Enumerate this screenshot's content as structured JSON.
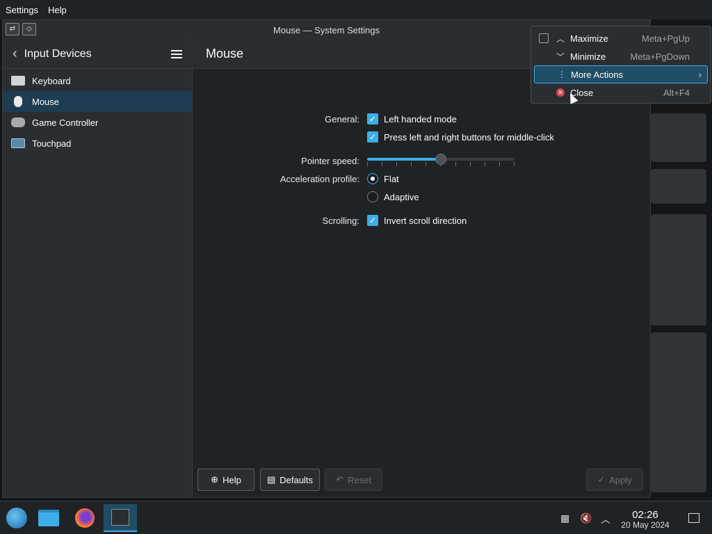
{
  "menubar": {
    "items": [
      "Settings",
      "Help"
    ]
  },
  "window": {
    "title": "Mouse — System Settings",
    "titlebar_icons": [
      "pin-icon",
      "keep-above-icon"
    ]
  },
  "sidebar": {
    "back_label": "Input Devices",
    "items": [
      {
        "label": "Keyboard",
        "icon": "keyboard-icon",
        "active": false
      },
      {
        "label": "Mouse",
        "icon": "mouse-icon",
        "active": true
      },
      {
        "label": "Game Controller",
        "icon": "gamepad-icon",
        "active": false
      },
      {
        "label": "Touchpad",
        "icon": "touchpad-icon",
        "active": false
      }
    ]
  },
  "main": {
    "title": "Mouse",
    "general_label": "General:",
    "left_handed_label": "Left handed mode",
    "left_handed_checked": true,
    "middle_click_label": "Press left and right buttons for middle-click",
    "middle_click_checked": true,
    "pointer_speed_label": "Pointer speed:",
    "pointer_speed_value": 0.5,
    "accel_label": "Acceleration profile:",
    "accel_options": [
      "Flat",
      "Adaptive"
    ],
    "accel_selected": "Flat",
    "scrolling_label": "Scrolling:",
    "invert_scroll_label": "Invert scroll direction",
    "invert_scroll_checked": true
  },
  "buttons": {
    "help": "Help",
    "defaults": "Defaults",
    "reset": "Reset",
    "apply": "Apply"
  },
  "context_menu": {
    "items": [
      {
        "label": "Maximize",
        "shortcut": "Meta+PgUp",
        "icon": "chevron-up-icon"
      },
      {
        "label": "Minimize",
        "shortcut": "Meta+PgDown",
        "icon": "chevron-down-icon"
      },
      {
        "label": "More Actions",
        "shortcut": "",
        "icon": "more-vertical-icon"
      },
      {
        "label": "Close",
        "shortcut": "Alt+F4",
        "icon": "close-icon"
      }
    ],
    "highlighted": "More Actions"
  },
  "taskbar": {
    "apps": [
      "start-menu-icon",
      "file-manager-icon",
      "firefox-icon",
      "system-settings-icon"
    ],
    "time": "02:26",
    "date": "20 May 2024"
  },
  "colors": {
    "accent": "#3daee9",
    "window_bg": "#202326",
    "panel_bg": "#2a2e32",
    "close_red": "#da4453"
  }
}
